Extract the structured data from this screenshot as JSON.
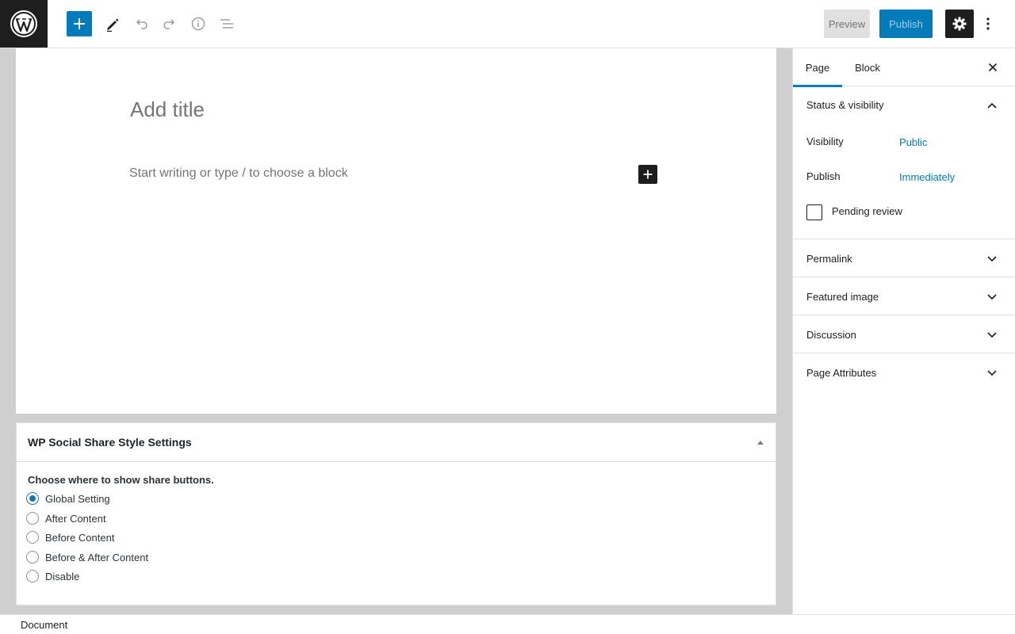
{
  "toolbar": {
    "preview_label": "Preview",
    "publish_label": "Publish",
    "icons": [
      "wordpress-logo-icon",
      "plus-icon",
      "pencil-icon",
      "undo-icon",
      "redo-icon",
      "info-icon",
      "list-view-icon",
      "gear-icon",
      "more-vertical-icon"
    ]
  },
  "editor": {
    "title_placeholder": "Add title",
    "block_placeholder": "Start writing or type / to choose a block"
  },
  "metabox": {
    "title": "WP Social Share Style Settings",
    "question": "Choose where to show share buttons.",
    "options": [
      {
        "label": "Global Setting",
        "checked": true
      },
      {
        "label": "After Content",
        "checked": false
      },
      {
        "label": "Before Content",
        "checked": false
      },
      {
        "label": "Before & After Content",
        "checked": false
      },
      {
        "label": "Disable",
        "checked": false
      }
    ]
  },
  "sidebar": {
    "tabs": [
      "Page",
      "Block"
    ],
    "status": {
      "title": "Status & visibility",
      "visibility_label": "Visibility",
      "visibility_value": "Public",
      "publish_label": "Publish",
      "publish_value": "Immediately",
      "pending_label": "Pending review"
    },
    "panels": [
      "Permalink",
      "Featured image",
      "Discussion",
      "Page Attributes"
    ]
  },
  "footer": {
    "breadcrumb": "Document"
  },
  "colors": {
    "accent": "#007cba",
    "dark": "#1e1e1e",
    "editor_bg": "#cfcfcf"
  }
}
